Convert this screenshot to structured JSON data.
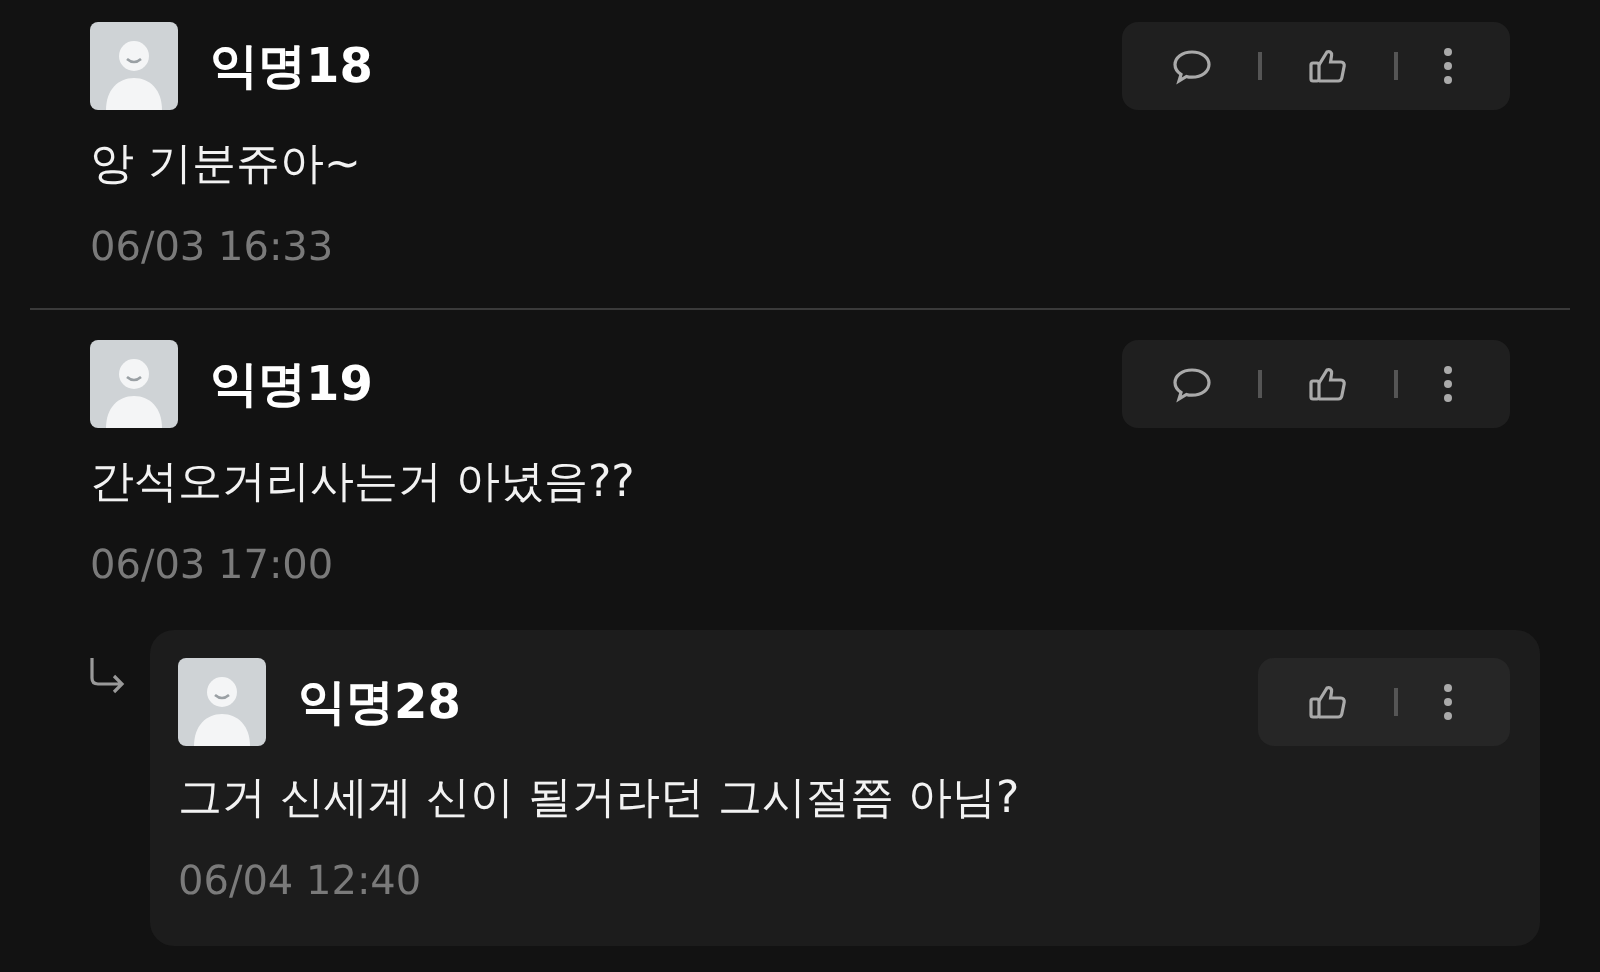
{
  "comments": [
    {
      "author": "익명18",
      "text": "앙 기분쥬아~",
      "time": "06/03 16:33",
      "actions": [
        {
          "kind": "reply"
        },
        {
          "kind": "like"
        },
        {
          "kind": "more"
        }
      ]
    },
    {
      "author": "익명19",
      "text": "간석오거리사는거 아녔음??",
      "time": "06/03 17:00",
      "actions": [
        {
          "kind": "reply"
        },
        {
          "kind": "like"
        },
        {
          "kind": "more"
        }
      ],
      "replies": [
        {
          "author": "익명28",
          "text": "그거 신세계 신이 될거라던 그시절쯤 아님?",
          "time": "06/04 12:40",
          "actions": [
            {
              "kind": "like"
            },
            {
              "kind": "more"
            }
          ]
        }
      ]
    }
  ]
}
